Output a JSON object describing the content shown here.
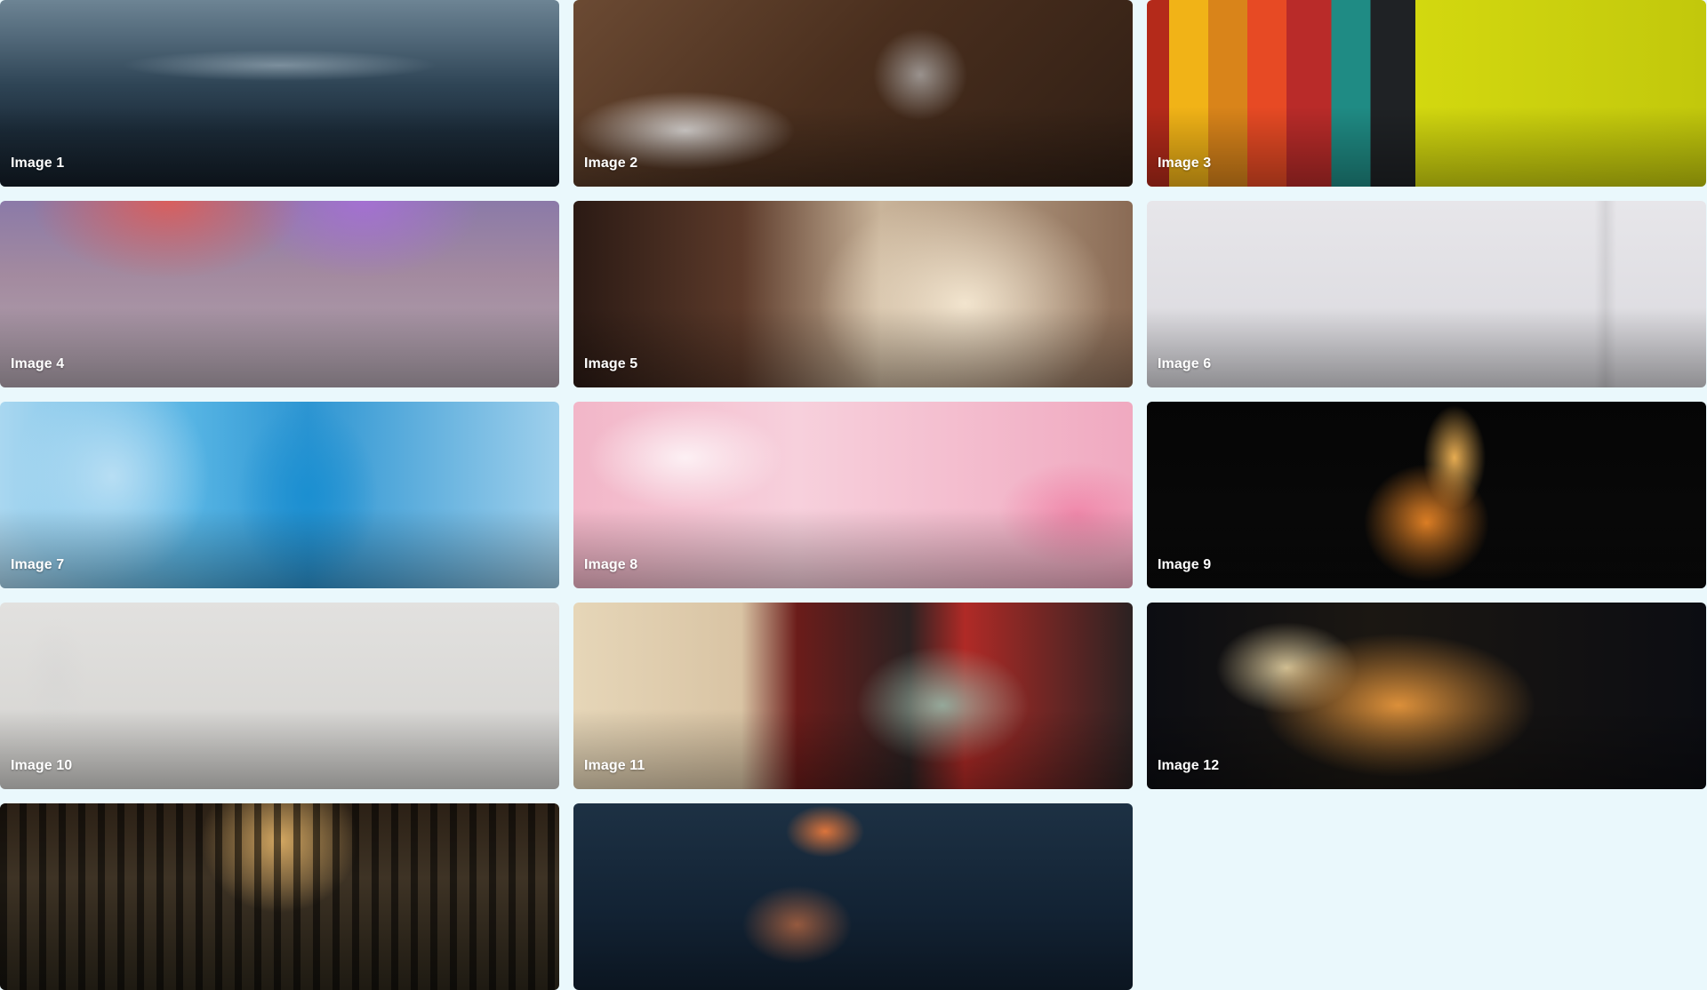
{
  "gallery": {
    "items": [
      {
        "label": "Image 1"
      },
      {
        "label": "Image 2"
      },
      {
        "label": "Image 3"
      },
      {
        "label": "Image 4"
      },
      {
        "label": "Image 5"
      },
      {
        "label": "Image 6"
      },
      {
        "label": "Image 7"
      },
      {
        "label": "Image 8"
      },
      {
        "label": "Image 9"
      },
      {
        "label": "Image 10"
      },
      {
        "label": "Image 11"
      },
      {
        "label": "Image 12"
      },
      {
        "label": ""
      },
      {
        "label": ""
      }
    ]
  },
  "colors": {
    "page_background": "#eaf8fc",
    "caption_text": "#ffffff"
  }
}
